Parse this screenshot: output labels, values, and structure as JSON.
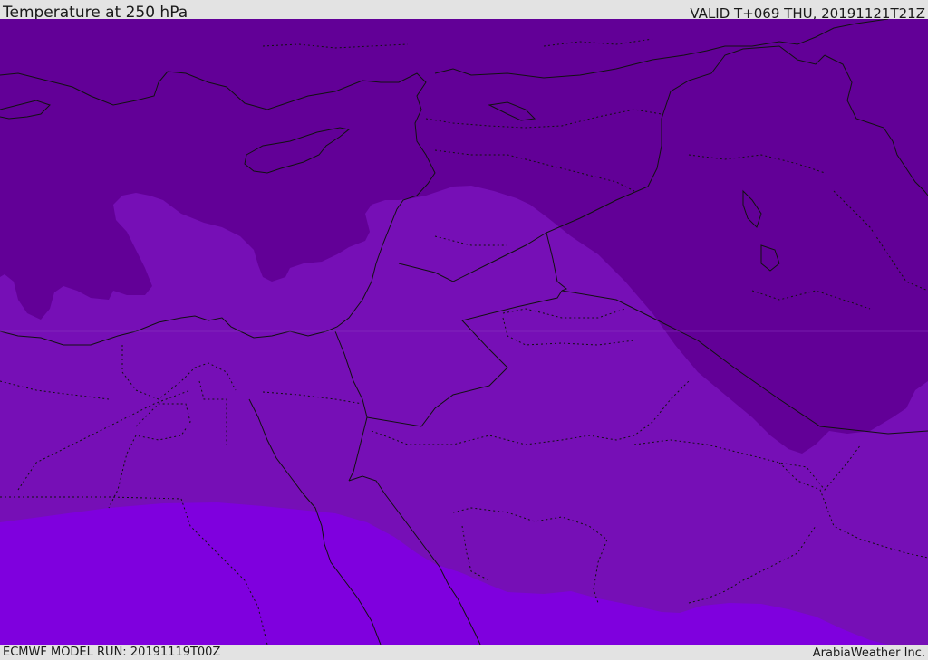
{
  "header": {
    "title": "Temperature at 250 hPa",
    "valid_time": "VALID T+069 THU, 20191121T21Z"
  },
  "footer": {
    "model_run": "ECMWF MODEL RUN: 20191119T00Z",
    "credit": "ArabiaWeather Inc."
  },
  "map": {
    "field": "Temperature at 250 hPa",
    "colors": {
      "cold_band": "#620097",
      "mid_band": "#760fb6",
      "warm_band": "#7f00de",
      "border_line": "#111111"
    }
  }
}
